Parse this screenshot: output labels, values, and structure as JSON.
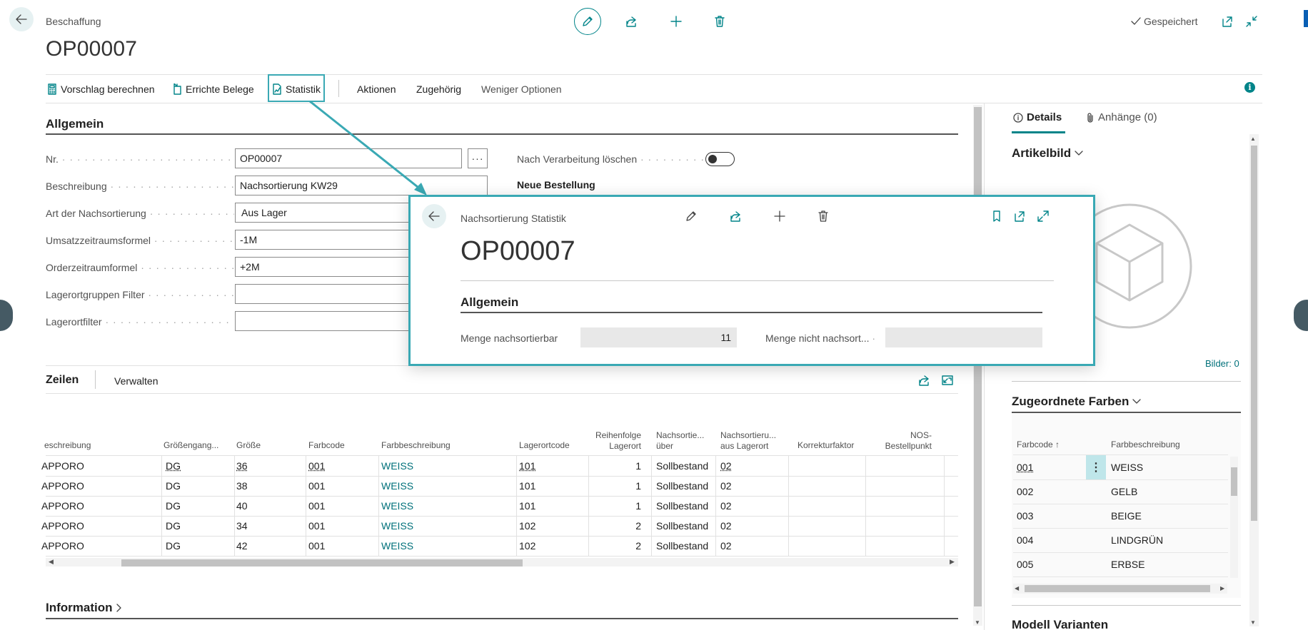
{
  "header": {
    "breadcrumb": "Beschaffung",
    "title": "OP00007",
    "saved_label": "Gespeichert"
  },
  "actions": {
    "items": [
      "Vorschlag berechnen",
      "Errichte Belege",
      "Statistik",
      "Aktionen",
      "Zugehörig",
      "Weniger Optionen"
    ]
  },
  "general": {
    "title": "Allgemein",
    "fields": [
      {
        "label": "Nr.",
        "value": "OP00007"
      },
      {
        "label": "Beschreibung",
        "value": "Nachsortierung KW29"
      },
      {
        "label": "Art der Nachsortierung",
        "value": "Aus Lager"
      },
      {
        "label": "Umsatzzeitraumsformel",
        "value": "-1M"
      },
      {
        "label": "Orderzeitraumformel",
        "value": "+2M"
      },
      {
        "label": "Lagerortgruppen Filter",
        "value": ""
      },
      {
        "label": "Lagerortfilter",
        "value": ""
      }
    ],
    "right_label": "Nach Verarbeitung löschen",
    "new_order_label": "Neue Bestellung",
    "delete_after_processing": false
  },
  "lines": {
    "tab_label": "Zeilen",
    "manage_label": "Verwalten",
    "columns": [
      {
        "label": "eschreibung"
      },
      {
        "label": "Größengang..."
      },
      {
        "label": "Größe"
      },
      {
        "label": "Farbcode"
      },
      {
        "label": "Farbbeschreibung"
      },
      {
        "label": "Lagerortcode"
      },
      {
        "label": "Reihenfolge",
        "label2": "Lagerort"
      },
      {
        "label": "Nachsortie...",
        "label2": "über"
      },
      {
        "label": "Nachsortieru...",
        "label2": "aus Lagerort"
      },
      {
        "label": "Korrekturfaktor"
      },
      {
        "label": "NOS-",
        "label2": "Bestellpunkt"
      }
    ],
    "rows": [
      [
        "APPORO",
        "DG",
        "36",
        "001",
        "WEISS",
        "101",
        "1",
        "Sollbestand",
        "02",
        "",
        ""
      ],
      [
        "APPORO",
        "DG",
        "38",
        "001",
        "WEISS",
        "101",
        "1",
        "Sollbestand",
        "02",
        "",
        ""
      ],
      [
        "APPORO",
        "DG",
        "40",
        "001",
        "WEISS",
        "101",
        "1",
        "Sollbestand",
        "02",
        "",
        ""
      ],
      [
        "APPORO",
        "DG",
        "34",
        "001",
        "WEISS",
        "102",
        "2",
        "Sollbestand",
        "02",
        "",
        ""
      ],
      [
        "APPORO",
        "DG",
        "42",
        "001",
        "WEISS",
        "102",
        "2",
        "Sollbestand",
        "02",
        "",
        ""
      ]
    ]
  },
  "information": {
    "title": "Information"
  },
  "right_pane": {
    "tabs": [
      "Details",
      "Anhänge (0)"
    ],
    "picture_title": "Artikelbild",
    "pictures_count": "Bilder: 0",
    "colors_title": "Zugeordnete Farben",
    "colors_columns": [
      "Farbcode ↑",
      "Farbbeschreibung"
    ],
    "colors": [
      {
        "code": "001",
        "desc": "WEISS"
      },
      {
        "code": "002",
        "desc": "GELB"
      },
      {
        "code": "003",
        "desc": "BEIGE"
      },
      {
        "code": "004",
        "desc": "LINDGRÜN"
      },
      {
        "code": "005",
        "desc": "ERBSE"
      }
    ],
    "variants_title": "Modell Varianten"
  },
  "modal": {
    "breadcrumb": "Nachsortierung Statistik",
    "title": "OP00007",
    "section": "Allgemein",
    "field1_label": "Menge nachsortierbar",
    "field1_value": "11",
    "field2_label": "Menge nicht nachsort...",
    "field2_value": ""
  },
  "colors": {
    "accent": "#008489",
    "highlight": "#3aa9b4"
  }
}
